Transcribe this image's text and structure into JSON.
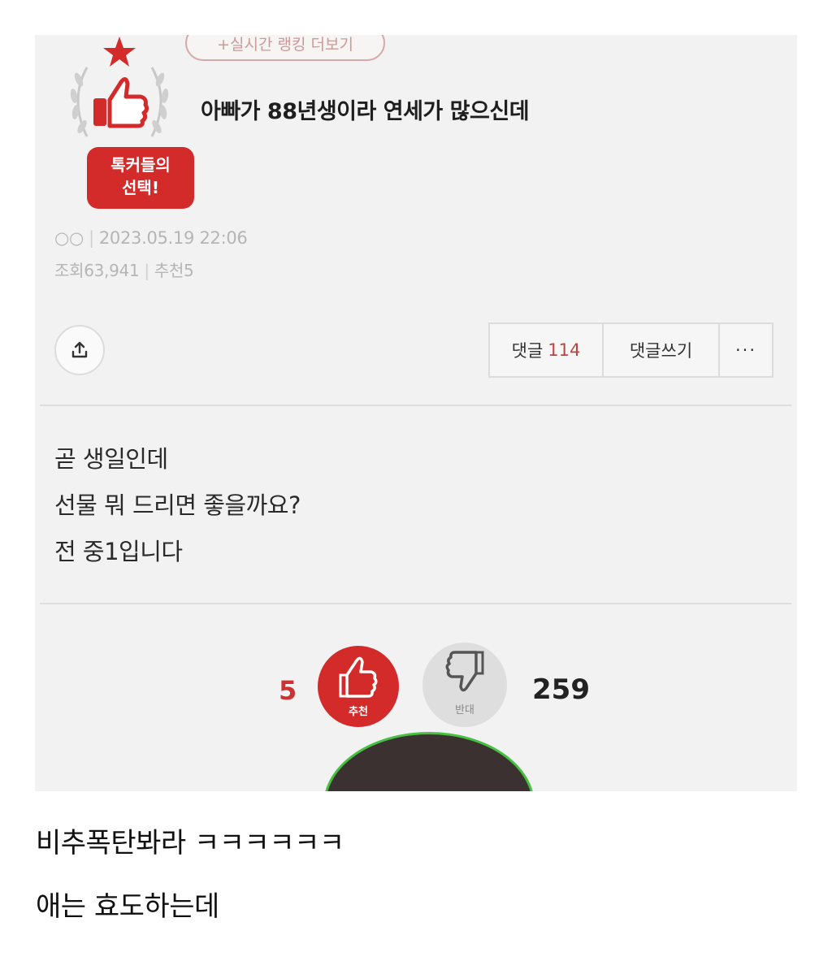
{
  "post": {
    "ranking_link": "+실시간 랭킹 더보기",
    "badge_line1": "톡커들의",
    "badge_line2": "선택!",
    "title": "아빠가 88년생이라 연세가 많으신데",
    "author": "○○",
    "datetime": "2023.05.19 22:06",
    "views": "조회63,941",
    "recommends": "추천5",
    "comments_label": "댓글",
    "comments_count": "114",
    "write_comment_label": "댓글쓰기",
    "more_label": "···",
    "body_lines": [
      "곧 생일인데",
      "선물 뭐 드리면 좋을까요?",
      "전 중1입니다"
    ],
    "vote_up_count": "5",
    "vote_up_label": "추천",
    "vote_down_label": "반대",
    "vote_down_count": "259"
  },
  "captions": [
    "비추폭탄봐라 ㅋㅋㅋㅋㅋㅋ",
    "애는 효도하는데"
  ],
  "colors": {
    "accent": "#d32a2a",
    "page_bg": "#f2f2f2"
  },
  "icons": {
    "badge": "thumbs-up-laurel-icon",
    "share": "share-icon",
    "up": "thumbs-up-icon",
    "down": "thumbs-down-icon"
  }
}
